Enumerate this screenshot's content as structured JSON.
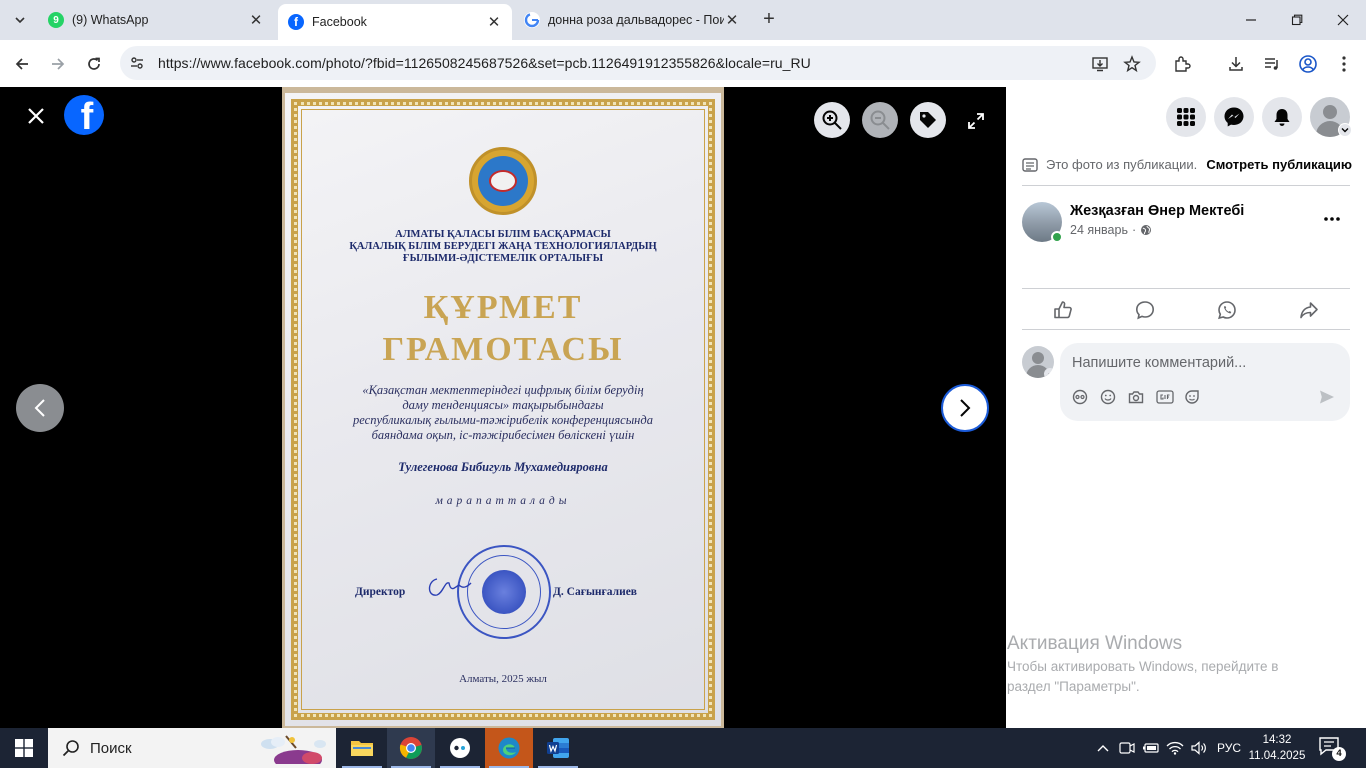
{
  "browser": {
    "tabs": [
      {
        "title": "(9) WhatsApp",
        "favicon": "whatsapp-icon",
        "color": "#25d366"
      },
      {
        "title": "Facebook",
        "favicon": "facebook-icon",
        "color": "#0866ff"
      },
      {
        "title": "донна роза дальвадорес - Пои",
        "favicon": "google-icon",
        "color": "#4285f4"
      }
    ],
    "url": "https://www.facebook.com/photo/?fbid=1126508245687526&set=pcb.1126491912355826&locale=ru_RU"
  },
  "certificate": {
    "org_lines": [
      "АЛМАТЫ ҚАЛАСЫ БІЛІМ БАСҚАРМАСЫ",
      "ҚАЛАЛЫҚ БІЛІМ БЕРУДЕГІ ЖАҢА ТЕХНОЛОГИЯЛАРДЫҢ",
      "ҒЫЛЫМИ-ӘДІСТЕМЕЛІК ОРТАЛЫҒЫ"
    ],
    "title_line1": "ҚҰРМЕТ",
    "title_line2": "ГРАМОТАСЫ",
    "body_lines": [
      "«Қазақстан мектептеріндегі цифрлық білім берудің",
      "даму тенденциясы»  тақырыбындағы",
      "республикалық ғылыми-тәжірибелік конференциясында",
      "баяндама оқып,  іс-тәжірибесімен бөліскені үшін"
    ],
    "recipient": "Тулегенова Бибигуль Мухамедияровна",
    "award_word": "марапатталады",
    "signer_role": "Директор",
    "signer_name": "Д. Сағынғалиев",
    "city_year": "Алматы, 2025 жыл"
  },
  "panel": {
    "post_note": "Это фото из публикации.",
    "view_post": "Смотреть публикацию",
    "author": "Жезқазған Өнер Мектебі",
    "date": "24 январь",
    "date_sep": "·",
    "comment_placeholder": "Напишите комментарий..."
  },
  "watermark": {
    "title": "Активация Windows",
    "line1": "Чтобы активировать Windows, перейдите в",
    "line2": "раздел \"Параметры\"."
  },
  "taskbar": {
    "search_label": "Поиск",
    "language": "РУС",
    "time": "14:32",
    "date": "11.04.2025",
    "notification_count": "4"
  }
}
